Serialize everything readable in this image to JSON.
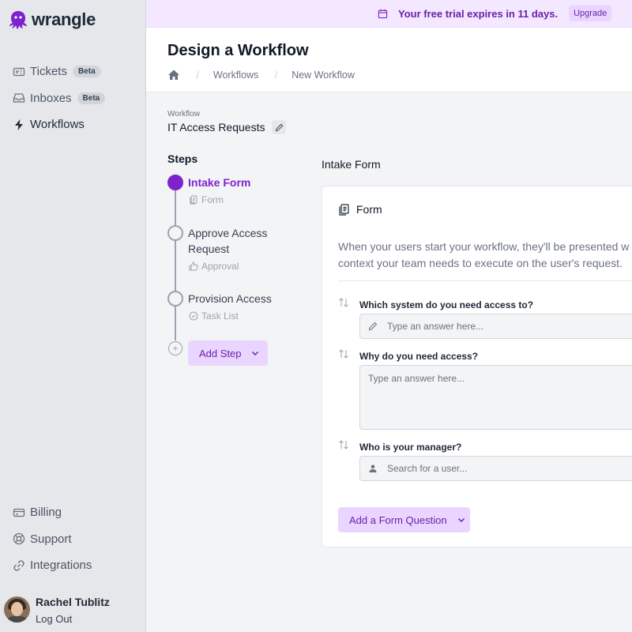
{
  "app": {
    "logo_text": "wrangle"
  },
  "sidebar": {
    "top_items": [
      {
        "label": "Tickets",
        "badge": "Beta",
        "icon": "ticket-icon"
      },
      {
        "label": "Inboxes",
        "badge": "Beta",
        "icon": "inbox-icon"
      },
      {
        "label": "Workflows",
        "badge": "",
        "icon": "bolt-icon",
        "active": true
      }
    ],
    "bottom_items": [
      {
        "label": "Billing",
        "icon": "credit-card-icon"
      },
      {
        "label": "Support",
        "icon": "lifebuoy-icon"
      },
      {
        "label": "Integrations",
        "icon": "link-icon"
      }
    ],
    "user": {
      "name": "Rachel Tublitz",
      "logout_label": "Log Out"
    }
  },
  "banner": {
    "message": "Your free trial expires in 11 days.",
    "upgrade_label": "Upgrade"
  },
  "header": {
    "title": "Design a Workflow",
    "breadcrumb": [
      "Workflows",
      "New Workflow"
    ]
  },
  "workflow": {
    "label": "Workflow",
    "name": "IT Access Requests"
  },
  "steps": {
    "heading": "Steps",
    "items": [
      {
        "title": "Intake Form",
        "type": "Form",
        "icon": "form-icon",
        "active": true
      },
      {
        "title": "Approve Access Request",
        "type": "Approval",
        "icon": "thumbs-up-icon"
      },
      {
        "title": "Provision Access",
        "type": "Task List",
        "icon": "check-circle-icon"
      }
    ],
    "add_label": "Add Step"
  },
  "panel": {
    "title": "Intake Form",
    "card_heading": "Form",
    "description_line1": "When your users start your workflow, they'll be presented w",
    "description_line2": "context your team needs to execute on the user's request.",
    "questions": [
      {
        "label": "Which system do you need access to?",
        "placeholder": "Type an answer here...",
        "kind": "text",
        "icon": "pencil-icon"
      },
      {
        "label": "Why do you need access?",
        "placeholder": "Type an answer here...",
        "kind": "textarea"
      },
      {
        "label": "Who is your manager?",
        "placeholder": "Search for a user...",
        "kind": "user",
        "icon": "user-icon"
      }
    ],
    "add_question_label": "Add a Form Question"
  },
  "colors": {
    "accent": "#7e22ce",
    "accent_light": "#e9d5ff",
    "banner_bg": "#f3e8ff"
  }
}
